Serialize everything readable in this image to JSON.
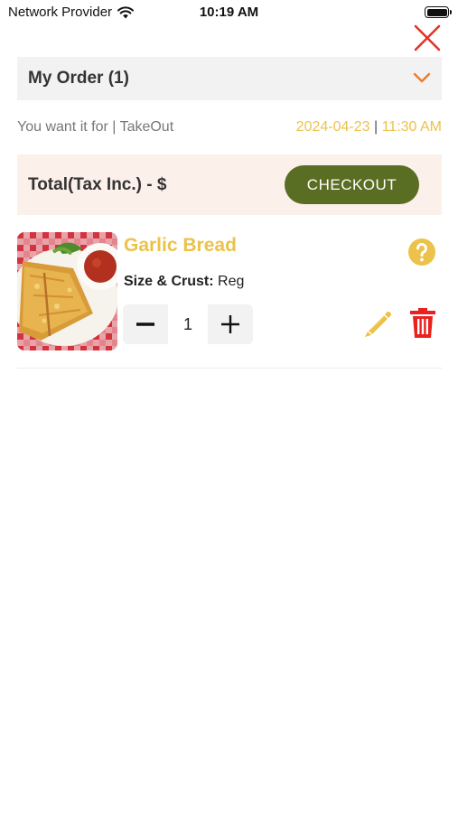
{
  "status_bar": {
    "carrier": "Network Provider",
    "time": "10:19 AM"
  },
  "order_bar": {
    "title": "My Order (1)"
  },
  "want_row": {
    "label": "You want it for | TakeOut",
    "date": "2024-04-23",
    "separator": "|",
    "time": "11:30 AM"
  },
  "total_bar": {
    "label": "Total(Tax Inc.) - $",
    "checkout_label": "CHECKOUT"
  },
  "items": [
    {
      "name": "Garlic Bread",
      "option_label": "Size & Crust:",
      "option_value": "Reg",
      "quantity": "1"
    }
  ],
  "colors": {
    "accent_yellow": "#ecc24a",
    "checkout_green": "#5a6e23",
    "delete_red": "#e8231f",
    "chevron_orange": "#f07b2a",
    "close_red": "#e0342a"
  },
  "icons": {
    "close": "close-icon",
    "chevron": "chevron-down-icon",
    "help": "question-circle-icon",
    "edit": "pencil-icon",
    "delete": "trash-icon",
    "minus": "minus-icon",
    "plus": "plus-icon"
  }
}
